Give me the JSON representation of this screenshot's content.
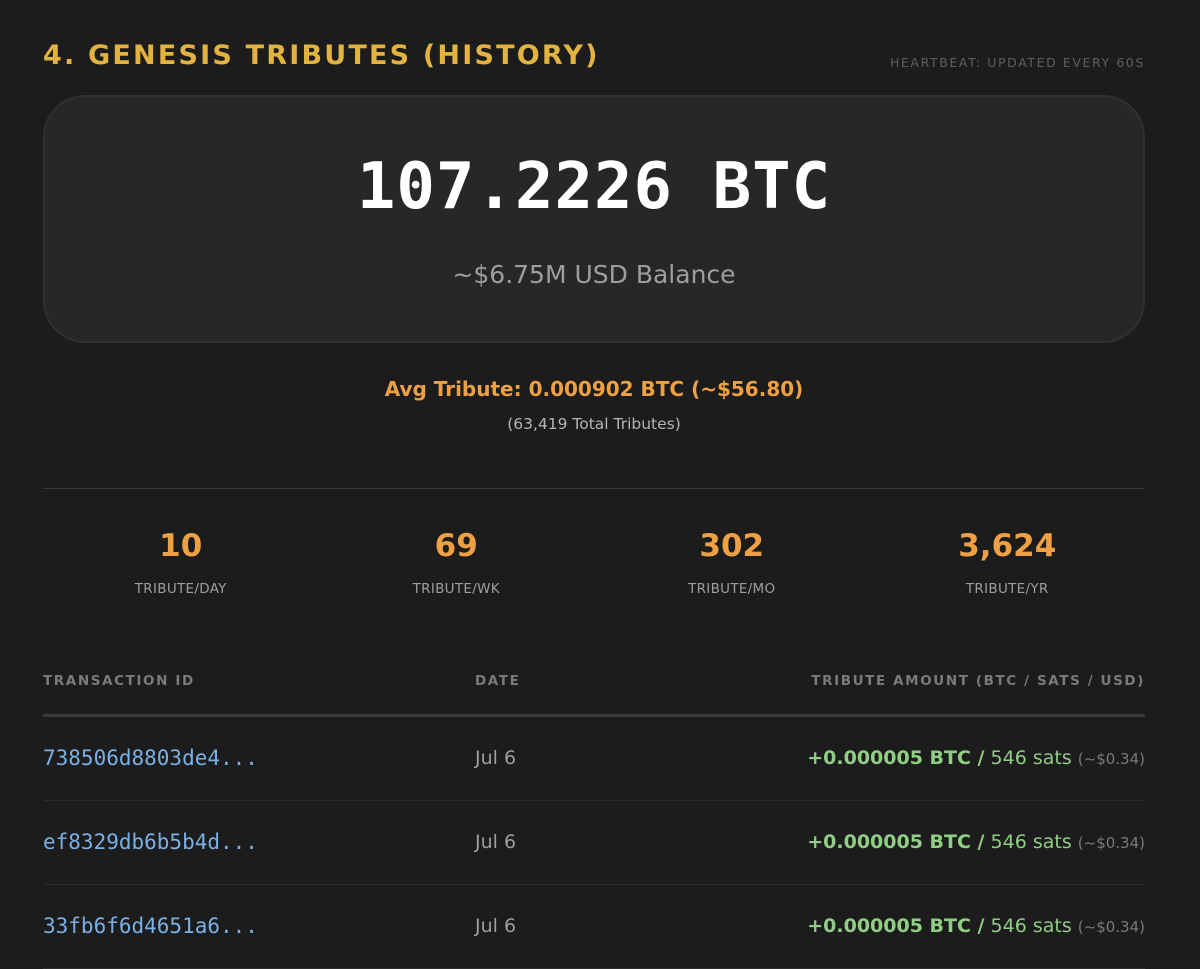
{
  "section": {
    "title": "4. GENESIS TRIBUTES (HISTORY)",
    "heartbeat": "HEARTBEAT: UPDATED EVERY 60S"
  },
  "balance": {
    "btc": "107.2226 BTC",
    "usd": "~$6.75M USD Balance"
  },
  "average": {
    "line": "Avg Tribute: 0.000902 BTC (~$56.80)",
    "total": "(63,419 Total Tributes)"
  },
  "stats": [
    {
      "value": "10",
      "label": "TRIBUTE/DAY"
    },
    {
      "value": "69",
      "label": "TRIBUTE/WK"
    },
    {
      "value": "302",
      "label": "TRIBUTE/MO"
    },
    {
      "value": "3,624",
      "label": "TRIBUTE/YR"
    }
  ],
  "table": {
    "headers": {
      "id": "TRANSACTION ID",
      "date": "DATE",
      "amount": "TRIBUTE AMOUNT (BTC / SATS / USD)"
    },
    "rows": [
      {
        "id": "738506d8803de4...",
        "date": "Jul 6",
        "btc": "+0.000005 BTC /",
        "sats": "546 sats",
        "usd": "(~$0.34)"
      },
      {
        "id": "ef8329db6b5b4d...",
        "date": "Jul 6",
        "btc": "+0.000005 BTC /",
        "sats": "546 sats",
        "usd": "(~$0.34)"
      },
      {
        "id": "33fb6f6d4651a6...",
        "date": "Jul 6",
        "btc": "+0.000005 BTC /",
        "sats": "546 sats",
        "usd": "(~$0.34)"
      }
    ]
  },
  "colors": {
    "title_gold": "#e3b341",
    "accent_orange": "#efa043",
    "link_blue": "#79b0e6",
    "positive_green": "#8fce84",
    "background": "#1c1c1c",
    "card": "#272727"
  }
}
